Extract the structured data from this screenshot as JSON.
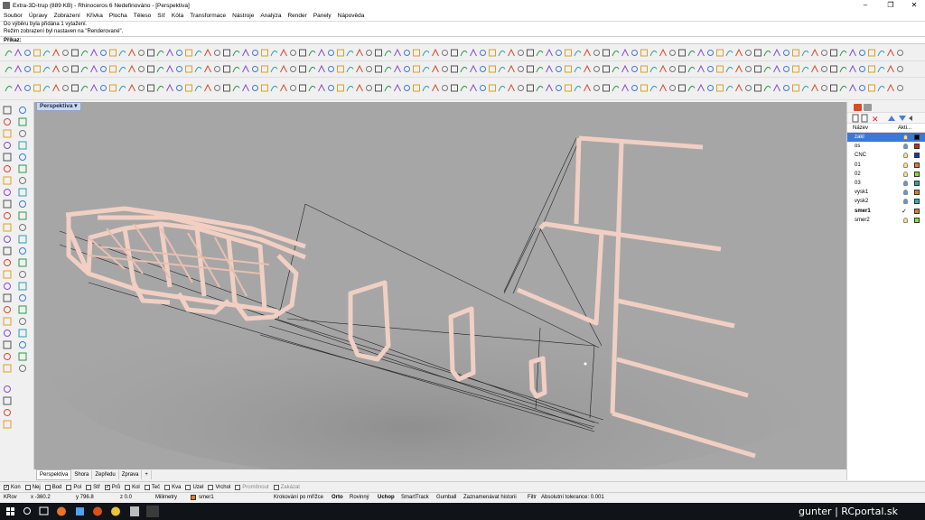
{
  "window": {
    "title": "Extra-3D-trup (889 KB) - Rhinoceros 6 Nedefinováno - [Perspektiva]",
    "controls": [
      "–",
      "❐",
      "✕"
    ]
  },
  "menu": [
    "Soubor",
    "Úpravy",
    "Zobrazení",
    "Křivka",
    "Plocha",
    "Těleso",
    "Síť",
    "Kóta",
    "Transformace",
    "Nástroje",
    "Analýza",
    "Render",
    "Panely",
    "Nápověda"
  ],
  "command_history": [
    "Do výběru byla přidána 1 vytažení.",
    "Režim zobrazení byl nastaven na \"Renderované\"."
  ],
  "command_prompt": "Příkaz:",
  "viewport": {
    "name": "Perspektiva",
    "background": "#a6a6a6",
    "model_color": "#f1cfc3"
  },
  "view_tabs": [
    "Perspektiva",
    "Shora",
    "Zepředu",
    "Zprava"
  ],
  "layers_panel": {
    "columns": [
      "Název",
      "Akti..."
    ],
    "layers": [
      {
        "name": "zakl",
        "current": false,
        "selected": true,
        "bulb": "yellow",
        "color": "#000000"
      },
      {
        "name": "os",
        "current": false,
        "selected": false,
        "bulb": "blue",
        "color": "#e02020"
      },
      {
        "name": "CNC",
        "current": false,
        "selected": false,
        "bulb": "yellow",
        "color": "#1530c8"
      },
      {
        "name": "01",
        "current": false,
        "selected": false,
        "bulb": "yellow",
        "color": "#e07b2a"
      },
      {
        "name": "02",
        "current": false,
        "selected": false,
        "bulb": "yellow",
        "color": "#8bdc2a"
      },
      {
        "name": "03",
        "current": false,
        "selected": false,
        "bulb": "blue",
        "color": "#2aa89a"
      },
      {
        "name": "vysk1",
        "current": false,
        "selected": false,
        "bulb": "blue",
        "color": "#e07b2a"
      },
      {
        "name": "vysk2",
        "current": false,
        "selected": false,
        "bulb": "blue",
        "color": "#2ab0b0"
      },
      {
        "name": "smer1",
        "current": true,
        "selected": false,
        "bulb": "",
        "color": "#e07b2a"
      },
      {
        "name": "smer2",
        "current": false,
        "selected": false,
        "bulb": "yellow",
        "color": "#8bdc2a"
      }
    ]
  },
  "osnap": [
    {
      "label": "Kon",
      "checked": true
    },
    {
      "label": "Nej",
      "checked": false
    },
    {
      "label": "Bod",
      "checked": false
    },
    {
      "label": "Pol",
      "checked": false
    },
    {
      "label": "Stř",
      "checked": false
    },
    {
      "label": "Prů",
      "checked": true
    },
    {
      "label": "Kol",
      "checked": false
    },
    {
      "label": "Teč",
      "checked": false
    },
    {
      "label": "Kva",
      "checked": false
    },
    {
      "label": "Uzel",
      "checked": false
    },
    {
      "label": "Vrchol",
      "checked": false
    },
    {
      "label": "Promítnout",
      "checked": false,
      "disabled": true
    },
    {
      "label": "Zakázat",
      "checked": false,
      "disabled": true
    }
  ],
  "status": {
    "cplane": "KRov",
    "x": "x -360.2",
    "y": "y 796.8",
    "z": "z 0.0",
    "units": "Milimetry",
    "layer": "smer1",
    "toggles": [
      "Krokování po mřížce",
      "Orto",
      "Rovinný",
      "Uchop",
      "SmartTrack",
      "Gumball",
      "Zaznamenávat historii",
      "Filtr"
    ],
    "bold_toggles": [
      "Orto",
      "Uchop"
    ],
    "tolerance": "Absolutní tolerance: 0.001"
  },
  "taskbar": {
    "credit": "gunter | RCportal.sk"
  }
}
